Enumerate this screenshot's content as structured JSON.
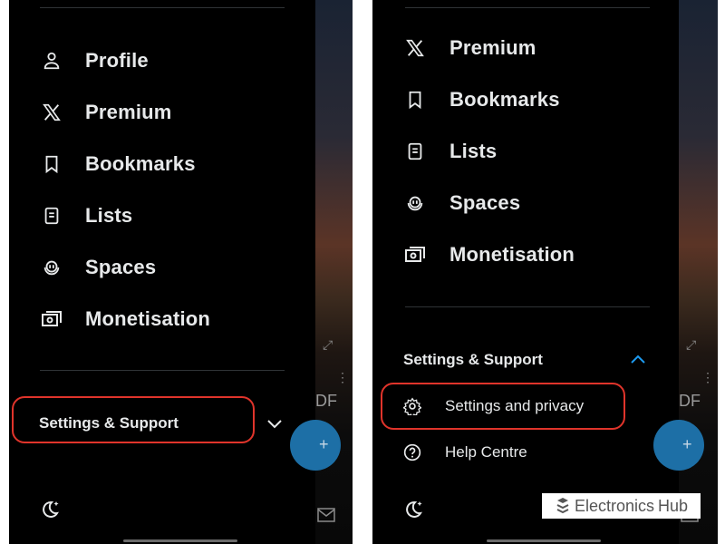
{
  "left": {
    "menu": [
      {
        "key": "profile",
        "label": "Profile",
        "icon": "profile-icon"
      },
      {
        "key": "premium",
        "label": "Premium",
        "icon": "x-logo-icon"
      },
      {
        "key": "bookmarks",
        "label": "Bookmarks",
        "icon": "bookmark-icon"
      },
      {
        "key": "lists",
        "label": "Lists",
        "icon": "lists-icon"
      },
      {
        "key": "spaces",
        "label": "Spaces",
        "icon": "spaces-icon"
      },
      {
        "key": "monetisation",
        "label": "Monetisation",
        "icon": "monetisation-icon"
      }
    ],
    "section_title": "Settings & Support",
    "section_state": "collapsed",
    "background_text": "DF"
  },
  "right": {
    "menu": [
      {
        "key": "premium",
        "label": "Premium",
        "icon": "x-logo-icon"
      },
      {
        "key": "bookmarks",
        "label": "Bookmarks",
        "icon": "bookmark-icon"
      },
      {
        "key": "lists",
        "label": "Lists",
        "icon": "lists-icon"
      },
      {
        "key": "spaces",
        "label": "Spaces",
        "icon": "spaces-icon"
      },
      {
        "key": "monetisation",
        "label": "Monetisation",
        "icon": "monetisation-icon"
      }
    ],
    "section_title": "Settings & Support",
    "section_state": "expanded",
    "sub_items": [
      {
        "key": "settings_privacy",
        "label": "Settings and privacy",
        "icon": "gear-icon"
      },
      {
        "key": "help",
        "label": "Help Centre",
        "icon": "help-icon"
      }
    ],
    "background_text": "DF"
  },
  "watermark": {
    "brand": "Electronics",
    "brand2": "Hub",
    "icon": "electronics-hub-logo-icon"
  },
  "colors": {
    "background": "#000000",
    "text": "#e7e9ea",
    "divider": "#2f3336",
    "highlight": "#e0342b",
    "accent": "#1d9bf0"
  }
}
